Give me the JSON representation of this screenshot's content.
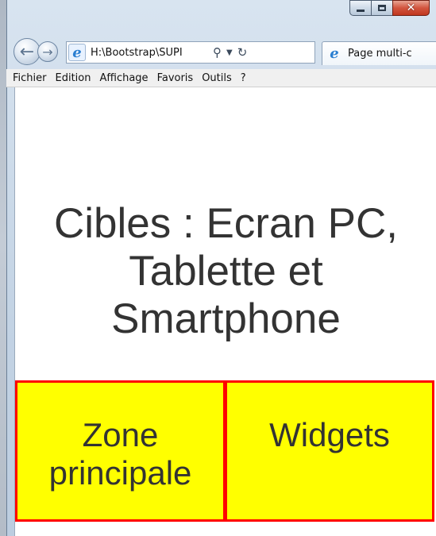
{
  "browser": {
    "caption_buttons": {
      "minimize": "minimize-icon",
      "maximize": "maximize-icon",
      "close": "✕"
    },
    "address_bar": {
      "value": "H:\\Bootstrap\\SUPI",
      "search_icon": "search-icon",
      "dropdown_icon": "chevron-down-icon",
      "refresh_icon": "refresh-icon"
    },
    "tab": {
      "label": "Page multi-c"
    }
  },
  "menubar": {
    "items": [
      "Fichier",
      "Edition",
      "Affichage",
      "Favoris",
      "Outils",
      "?"
    ]
  },
  "page": {
    "heading": "Cibles : Ecran PC, Tablette et Smartphone",
    "boxes": {
      "main_label": "Zone principale",
      "widgets_label": "Widgets"
    }
  },
  "colors": {
    "box_background": "#ffff00",
    "box_border": "#ff0000",
    "text": "#333333",
    "close_button": "#c0371f"
  }
}
